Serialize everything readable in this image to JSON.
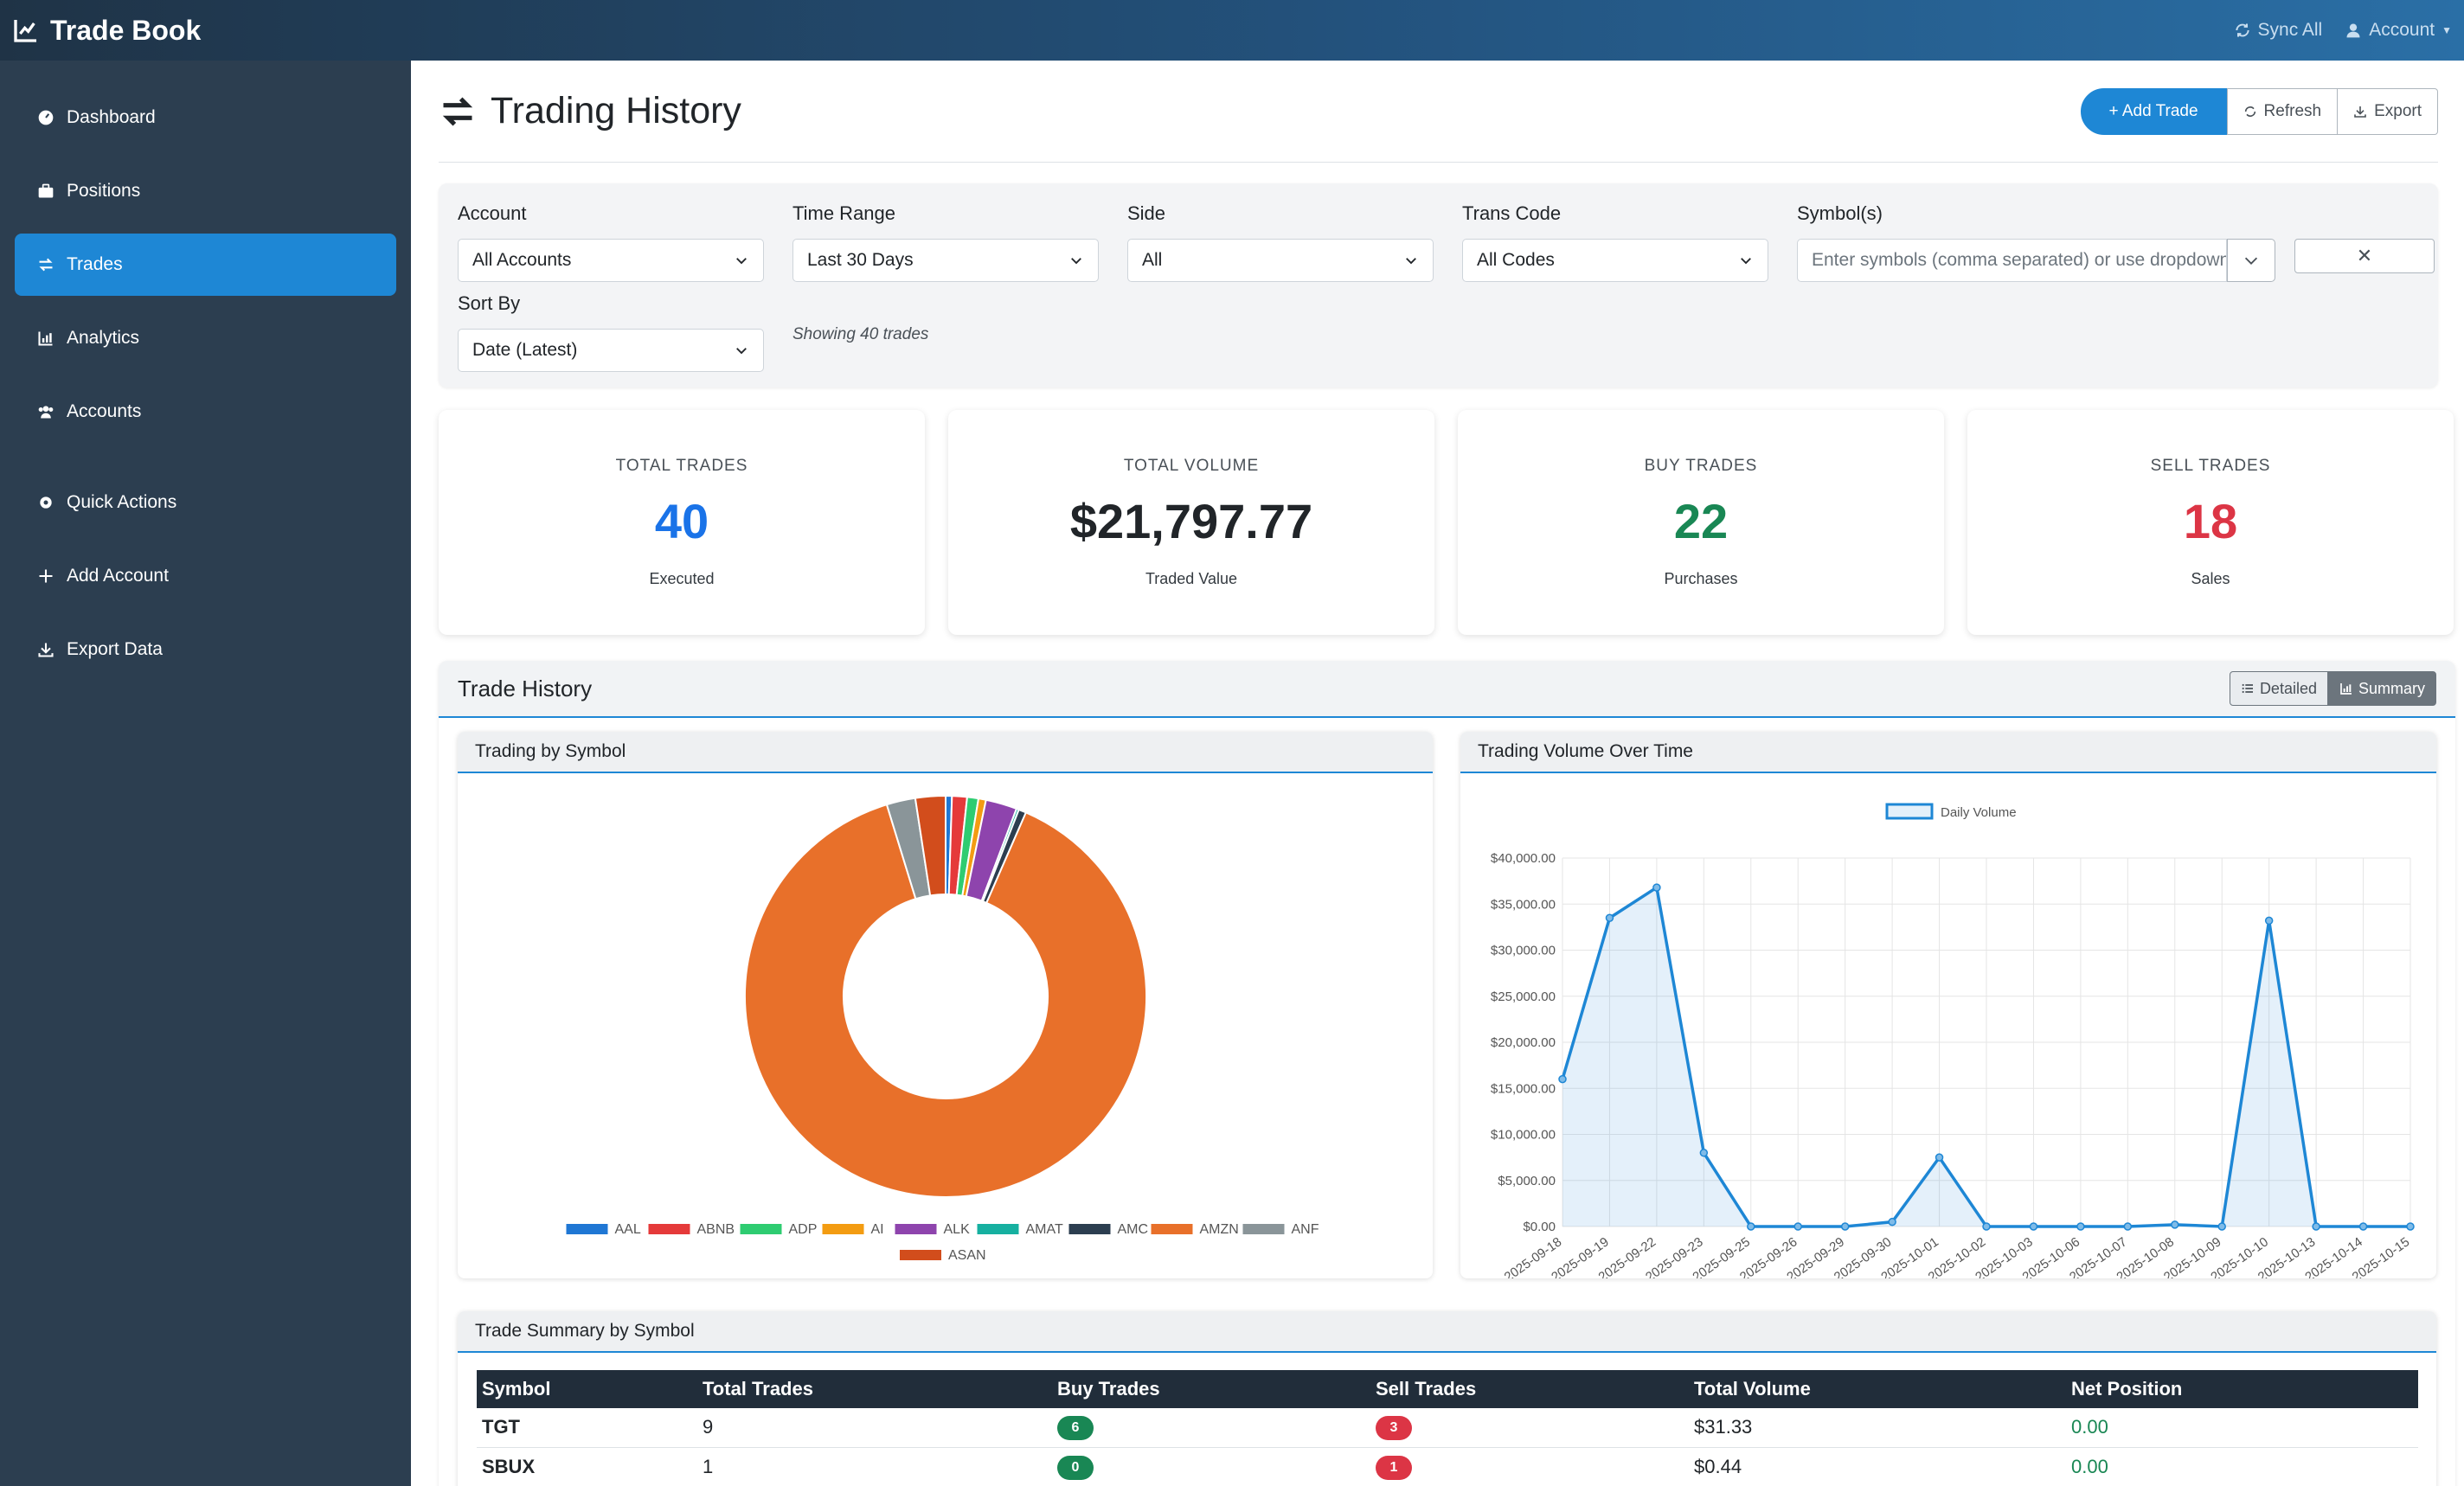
{
  "app": {
    "title": "Trade Book"
  },
  "topbar": {
    "sync_label": "Sync All",
    "account_label": "Account"
  },
  "sidebar": {
    "items": [
      {
        "label": "Dashboard",
        "icon": "gauge-icon"
      },
      {
        "label": "Positions",
        "icon": "briefcase-icon"
      },
      {
        "label": "Trades",
        "icon": "exchange-icon",
        "active": true
      },
      {
        "label": "Analytics",
        "icon": "chart-icon"
      },
      {
        "label": "Accounts",
        "icon": "users-icon"
      },
      {
        "label": "Quick Actions",
        "icon": "gear-icon"
      },
      {
        "label": "Add Account",
        "icon": "plus-icon"
      },
      {
        "label": "Export Data",
        "icon": "download-icon"
      }
    ]
  },
  "header": {
    "title": "Trading History",
    "add_trade": "+ Add Trade",
    "refresh": "Refresh",
    "export": "Export"
  },
  "filters": {
    "account": {
      "label": "Account",
      "value": "All Accounts"
    },
    "time_range": {
      "label": "Time Range",
      "value": "Last 30 Days"
    },
    "side": {
      "label": "Side",
      "value": "All"
    },
    "trans_code": {
      "label": "Trans Code",
      "value": "All Codes"
    },
    "symbols": {
      "label": "Symbol(s)",
      "placeholder": "Enter symbols (comma separated) or use dropdown"
    },
    "sort_by": {
      "label": "Sort By",
      "value": "Date (Latest)"
    },
    "clear": "✕",
    "showing": "Showing 40 trades"
  },
  "stats": [
    {
      "label": "TOTAL TRADES",
      "value": "40",
      "sub": "Executed",
      "color": "#1a73e8"
    },
    {
      "label": "TOTAL VOLUME",
      "value": "$21,797.77",
      "sub": "Traded Value",
      "color": "#212529"
    },
    {
      "label": "BUY TRADES",
      "value": "22",
      "sub": "Purchases",
      "color": "#198754"
    },
    {
      "label": "SELL TRADES",
      "value": "18",
      "sub": "Sales",
      "color": "#dc3545"
    }
  ],
  "history": {
    "title": "Trade History",
    "detailed": "Detailed",
    "summary": "Summary"
  },
  "chart_data": [
    {
      "type": "pie",
      "title": "Trading by Symbol",
      "categories": [
        "AAL",
        "ABNB",
        "ADP",
        "AI",
        "ALK",
        "AMAT",
        "AMC",
        "AMZN",
        "ANF",
        "ASAN"
      ],
      "values": [
        0.5,
        1.2,
        0.9,
        0.6,
        2.5,
        0.2,
        0.6,
        88.0,
        2.3,
        2.4
      ],
      "colors": [
        "#1f77d4",
        "#e53a3a",
        "#2ecc71",
        "#f39c12",
        "#8e44ad",
        "#16b0a0",
        "#2c3e50",
        "#e8702a",
        "#8a9599",
        "#d24d1c"
      ],
      "legend_position": "bottom"
    },
    {
      "type": "area",
      "title": "Trading Volume Over Time",
      "series": [
        {
          "name": "Daily Volume",
          "values": [
            16000,
            33500,
            36800,
            8000,
            0,
            0,
            0,
            500,
            7500,
            0,
            0,
            0,
            0,
            200,
            0,
            33200,
            0,
            0,
            0
          ]
        }
      ],
      "x": [
        "2025-09-18",
        "2025-09-19",
        "2025-09-22",
        "2025-09-23",
        "2025-09-25",
        "2025-09-26",
        "2025-09-29",
        "2025-09-30",
        "2025-10-01",
        "2025-10-02",
        "2025-10-03",
        "2025-10-06",
        "2025-10-07",
        "2025-10-08",
        "2025-10-09",
        "2025-10-10",
        "2025-10-13",
        "2025-10-14",
        "2025-10-15"
      ],
      "ylim": [
        0,
        40000
      ],
      "yticks": [
        "$0.00",
        "$5,000.00",
        "$10,000.00",
        "$15,000.00",
        "$20,000.00",
        "$25,000.00",
        "$30,000.00",
        "$35,000.00",
        "$40,000.00"
      ],
      "grid": true,
      "legend_position": "top",
      "color": "#1e87d5"
    }
  ],
  "summary_table": {
    "title": "Trade Summary by Symbol",
    "columns": [
      "Symbol",
      "Total Trades",
      "Buy Trades",
      "Sell Trades",
      "Total Volume",
      "Net Position"
    ],
    "rows": [
      {
        "symbol": "TGT",
        "total": "9",
        "buy": "6",
        "sell": "3",
        "volume": "$31.33",
        "net": "0.00"
      },
      {
        "symbol": "SBUX",
        "total": "1",
        "buy": "0",
        "sell": "1",
        "volume": "$0.44",
        "net": "0.00"
      }
    ]
  }
}
